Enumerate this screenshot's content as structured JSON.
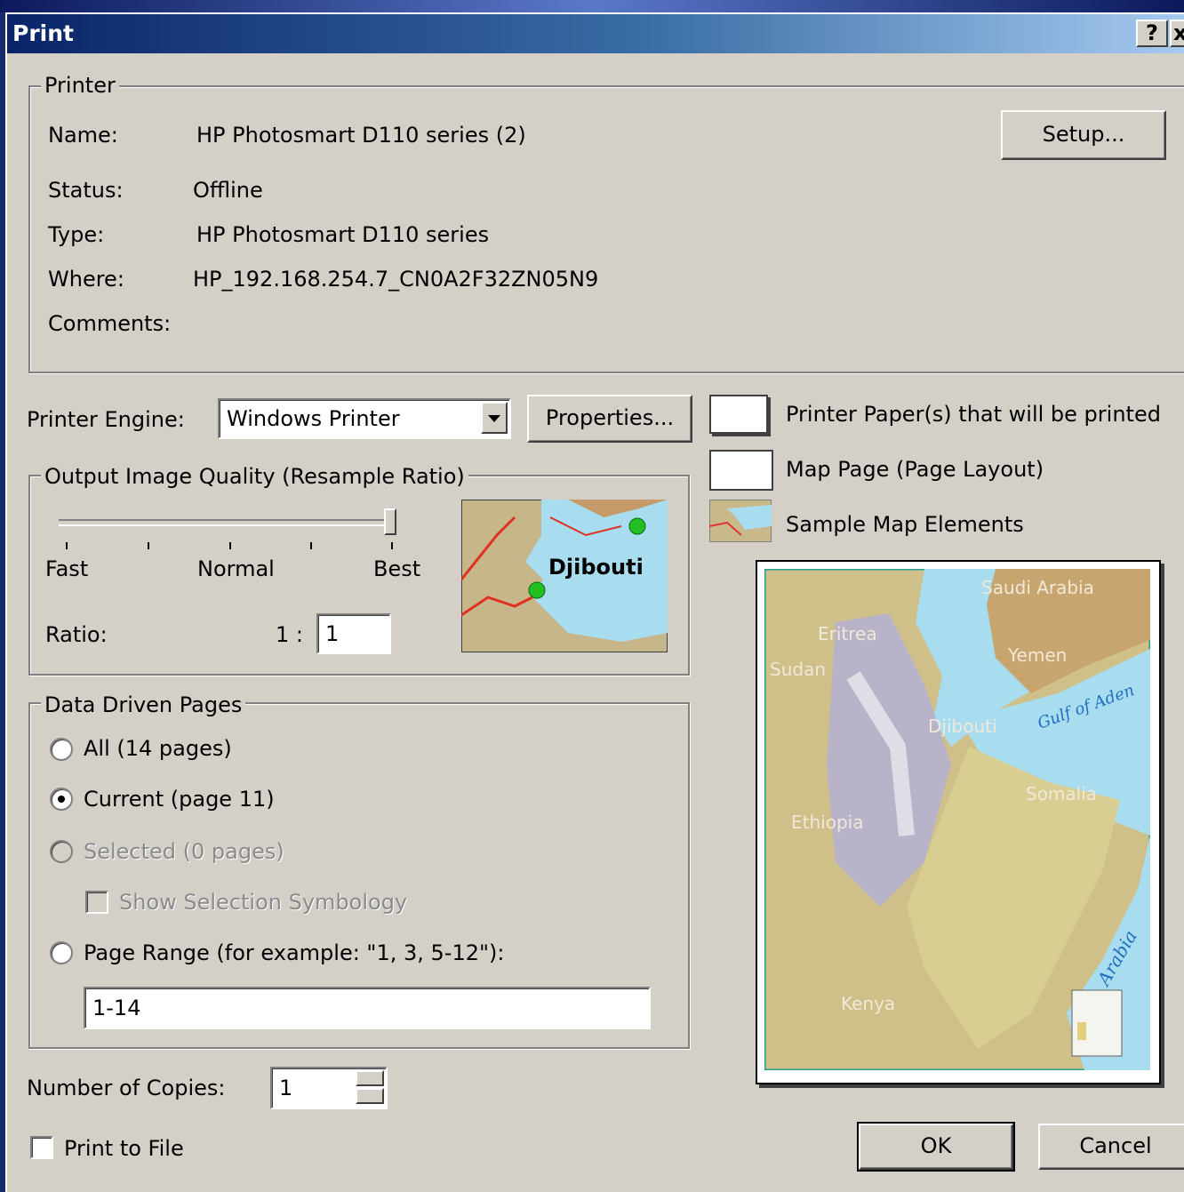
{
  "window": {
    "title": "Print",
    "help_glyph": "?",
    "close_glyph": "x"
  },
  "printer": {
    "group_title": "Printer",
    "name_label": "Name:",
    "name_value": "HP Photosmart D110 series (2)",
    "status_label": "Status:",
    "status_value": "Offline",
    "type_label": "Type:",
    "type_value": "HP Photosmart D110 series",
    "where_label": "Where:",
    "where_value": "HP_192.168.254.7_CN0A2F32ZN05N9",
    "comments_label": "Comments:",
    "setup_button": "Setup..."
  },
  "engine": {
    "label": "Printer Engine:",
    "selected": "Windows Printer",
    "properties_button": "Properties..."
  },
  "legend": {
    "paper": "Printer Paper(s) that will be printed",
    "map_page": "Map Page (Page Layout)",
    "sample": "Sample Map Elements"
  },
  "quality": {
    "group_title": "Output Image Quality (Resample Ratio)",
    "fast": "Fast",
    "normal": "Normal",
    "best": "Best",
    "slider_level": 1.0,
    "ratio_label": "Ratio:",
    "ratio_prefix": "1 :",
    "ratio_value": "1",
    "thumbnail_label": "Djibouti"
  },
  "ddp": {
    "group_title": "Data Driven Pages",
    "all": "All (14 pages)",
    "current": "Current (page 11)",
    "selected": "Selected (0 pages)",
    "show_selection": "Show Selection Symbology",
    "page_range": "Page Range (for example: \"1, 3, 5-12\"):",
    "range_value": "1-14",
    "selected_option": "current"
  },
  "copies": {
    "label": "Number of Copies:",
    "value": "1"
  },
  "print_to_file": {
    "label": "Print to File",
    "checked": false
  },
  "preview_map": {
    "labels": [
      "Saudi Arabia",
      "Eritrea",
      "Sudan",
      "Yemen",
      "Djibouti",
      "Gulf of Aden",
      "Somalia",
      "Ethiopia",
      "Kenya",
      "Arabia"
    ]
  },
  "buttons": {
    "ok": "OK",
    "cancel": "Cancel"
  },
  "colors": {
    "titlebar_start": "#0a246a",
    "titlebar_end": "#a6caf0",
    "dialog_face": "#d4d0c8",
    "water": "#a8dcef"
  }
}
